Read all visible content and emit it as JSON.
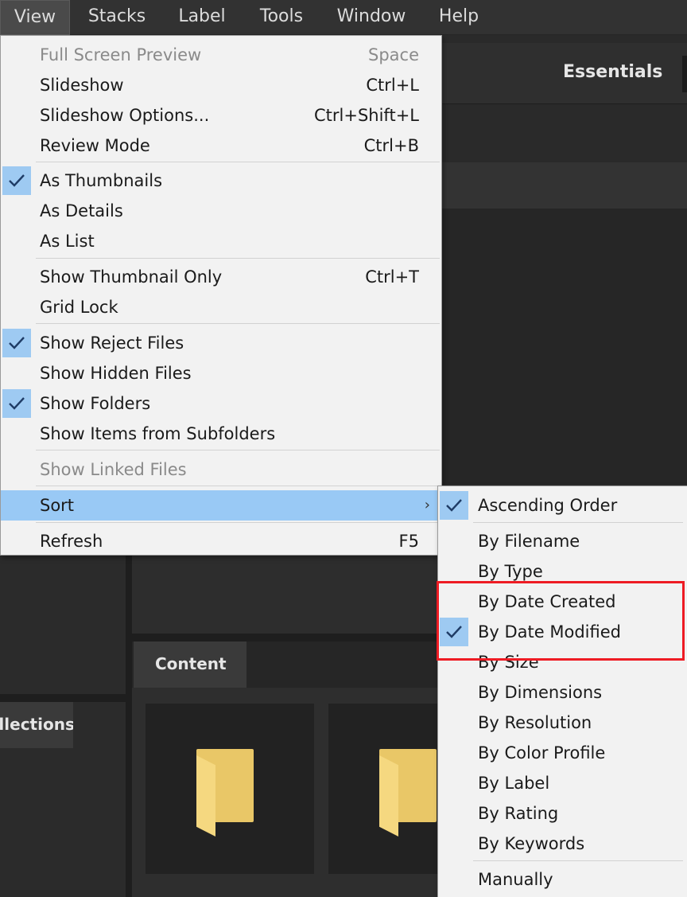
{
  "menubar": {
    "items": [
      {
        "label": "View",
        "active": true
      },
      {
        "label": "Stacks"
      },
      {
        "label": "Label"
      },
      {
        "label": "Tools"
      },
      {
        "label": "Window"
      },
      {
        "label": "Help"
      }
    ]
  },
  "workspace": {
    "essentials_label": "Essentials",
    "content_tab_label": "Content",
    "collections_tab_label": "Collections"
  },
  "view_menu": {
    "items": [
      {
        "label": "Full Screen Preview",
        "shortcut": "Space",
        "disabled": true
      },
      {
        "label": "Slideshow",
        "shortcut": "Ctrl+L"
      },
      {
        "label": "Slideshow Options...",
        "shortcut": "Ctrl+Shift+L"
      },
      {
        "label": "Review Mode",
        "shortcut": "Ctrl+B"
      },
      {
        "label": "As Thumbnails",
        "checked": true
      },
      {
        "label": "As Details"
      },
      {
        "label": "As List"
      },
      {
        "label": "Show Thumbnail Only",
        "shortcut": "Ctrl+T"
      },
      {
        "label": "Grid Lock"
      },
      {
        "label": "Show Reject Files",
        "checked": true
      },
      {
        "label": "Show Hidden Files"
      },
      {
        "label": "Show Folders",
        "checked": true
      },
      {
        "label": "Show Items from Subfolders"
      },
      {
        "label": "Show Linked Files",
        "disabled": true
      },
      {
        "label": "Sort",
        "submenu_arrow": "›",
        "highlighted": true
      },
      {
        "label": "Refresh",
        "shortcut": "F5"
      }
    ]
  },
  "sort_submenu": {
    "items": [
      {
        "label": "Ascending Order",
        "checked": true
      },
      {
        "label": "By Filename"
      },
      {
        "label": "By Type"
      },
      {
        "label": "By Date Created"
      },
      {
        "label": "By Date Modified",
        "checked": true
      },
      {
        "label": "By Size"
      },
      {
        "label": "By Dimensions"
      },
      {
        "label": "By Resolution"
      },
      {
        "label": "By Color Profile"
      },
      {
        "label": "By Label"
      },
      {
        "label": "By Rating"
      },
      {
        "label": "By Keywords"
      },
      {
        "label": "Manually"
      }
    ]
  },
  "colors": {
    "highlight": "#99c9f5",
    "check_bg": "#9ecaf2",
    "annotation_box": "#ee1c24",
    "folder": "#e9c767"
  }
}
